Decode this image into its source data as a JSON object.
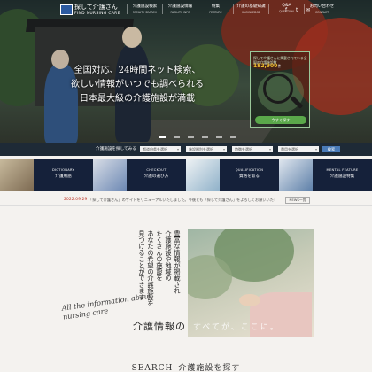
{
  "header": {
    "logo_title": "探して介護さん",
    "logo_sub": "FIND NURSING CARE",
    "nav": [
      {
        "jp": "介護施設検索",
        "en": "FACILITY SEARCH"
      },
      {
        "jp": "介護施設情報",
        "en": "FACILITY INFO"
      },
      {
        "jp": "特集",
        "en": "FEATURE"
      },
      {
        "jp": "介護の基礎知識",
        "en": "KNOWLEDGE"
      },
      {
        "jp": "Q&A",
        "en": "QUESTION"
      },
      {
        "jp": "お問い合わせ",
        "en": "CONTACT"
      }
    ],
    "social": [
      "f",
      "t",
      "✉"
    ]
  },
  "hero": {
    "line1": "全国対応、24時間ネット検索、",
    "line2": "欲しい情報がいつでも調べられる",
    "line3": "日本最大級の介護施設が満載",
    "slides_active": 0,
    "slides_total": 6
  },
  "widget": {
    "title": "探して介護さんに掲載されている全国の介護施設数",
    "count": "182,900",
    "count_suffix": "件",
    "button": "今すぐ探す"
  },
  "search_bar": {
    "label": "介護施設を探してみる",
    "select1": "都道府県を選択",
    "select2": "施設種別を選択",
    "select3": "特徴を選択",
    "select4": "費用を選択",
    "button": "検索"
  },
  "categories": [
    {
      "en": "DICTIONARY",
      "jp": "介護用語"
    },
    {
      "en": "CHECKOUT",
      "jp": "介護の選び方"
    },
    {
      "en": "QUALIFICATION",
      "jp": "資格を取る"
    },
    {
      "en": "MENTAL FEATURE",
      "jp": "介護施設特集"
    }
  ],
  "news": {
    "date": "2022.09.29",
    "text": "「探して介護さん」のサイトをリニューアルいたしました。今後とも「探して介護さん」をよろしくお願いいたします。",
    "more": "NEWS一覧"
  },
  "intro": {
    "columns": [
      "豊富な情報が掲載され",
      "介護施設や地域の",
      "たくさんの施設を",
      "あなたの希望の介護施設を",
      "見つけることができます"
    ],
    "script": "All the information about nursing care",
    "title": "介護情報の",
    "overlay": "すべてが、ここに。"
  },
  "section": {
    "heading_en": "SEARCH",
    "heading_jp": "介護施設を探す"
  },
  "colors": {
    "navy": "#15213a",
    "accent_green": "#5aa84a",
    "news_red": "#c0392b"
  }
}
